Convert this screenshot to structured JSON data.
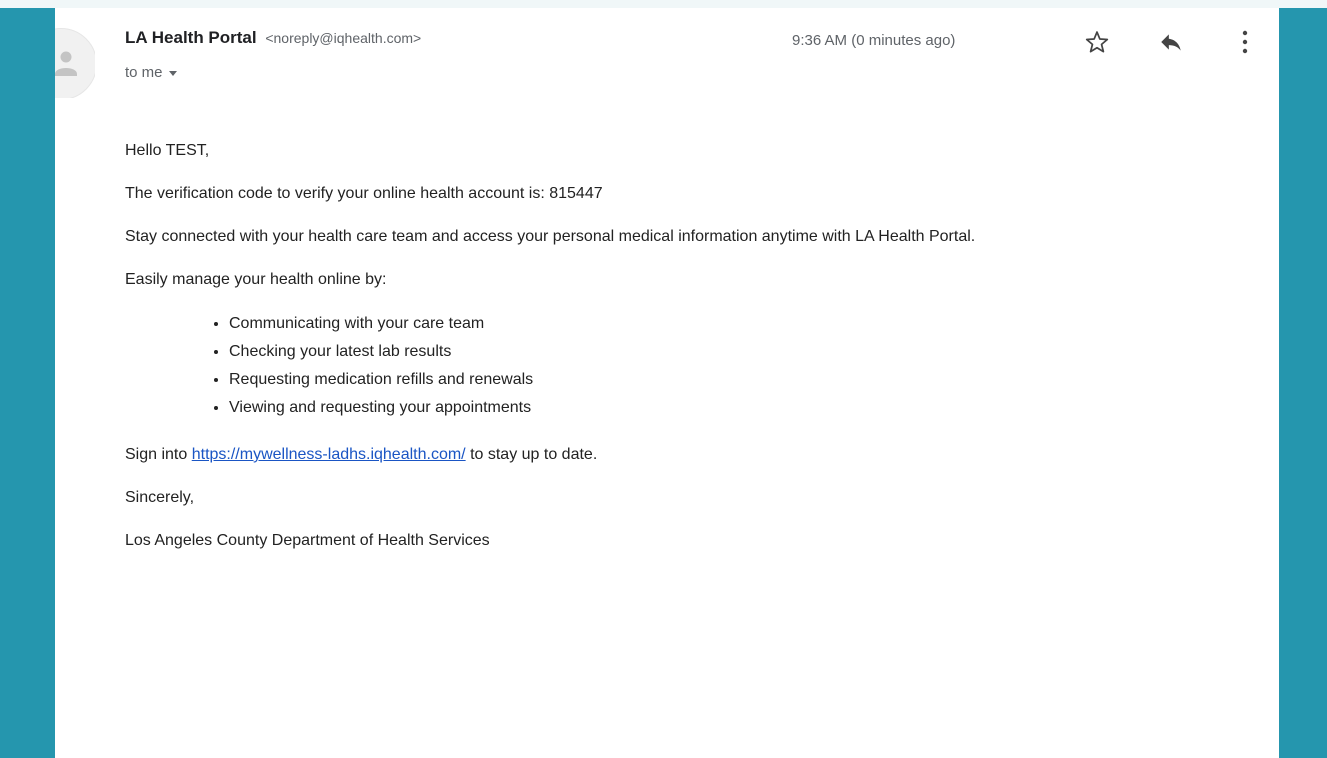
{
  "header": {
    "sender_name": "LA Health Portal",
    "sender_email": "<noreply@iqhealth.com>",
    "recipient": "to me",
    "time": "9:36 AM (0 minutes ago)"
  },
  "icons": {
    "avatar": "person-icon",
    "star": "star-outline-icon",
    "reply": "reply-icon",
    "more": "more-vertical-icon",
    "recipient_menu": "caret-down-icon"
  },
  "body": {
    "greeting": "Hello TEST,",
    "verification": "The verification code to verify your online health account is: 815447",
    "stay_connected": "Stay connected with your health care team and access your personal medical information anytime with LA Health Portal.",
    "manage_intro": "Easily manage your health online by:",
    "features": [
      "Communicating with your care team",
      "Checking your latest lab results",
      "Requesting medication refills and renewals",
      "Viewing and requesting your appointments"
    ],
    "sign_in_prefix": "Sign into ",
    "sign_in_link": "https://mywellness-ladhs.iqhealth.com/",
    "sign_in_suffix": " to stay up to date.",
    "closing": "Sincerely,",
    "signature": "Los Angeles County Department of Health Services"
  },
  "colors": {
    "frame": "#2596ae",
    "link": "#1a55c4",
    "text": "#222222",
    "muted": "#5f6368"
  }
}
